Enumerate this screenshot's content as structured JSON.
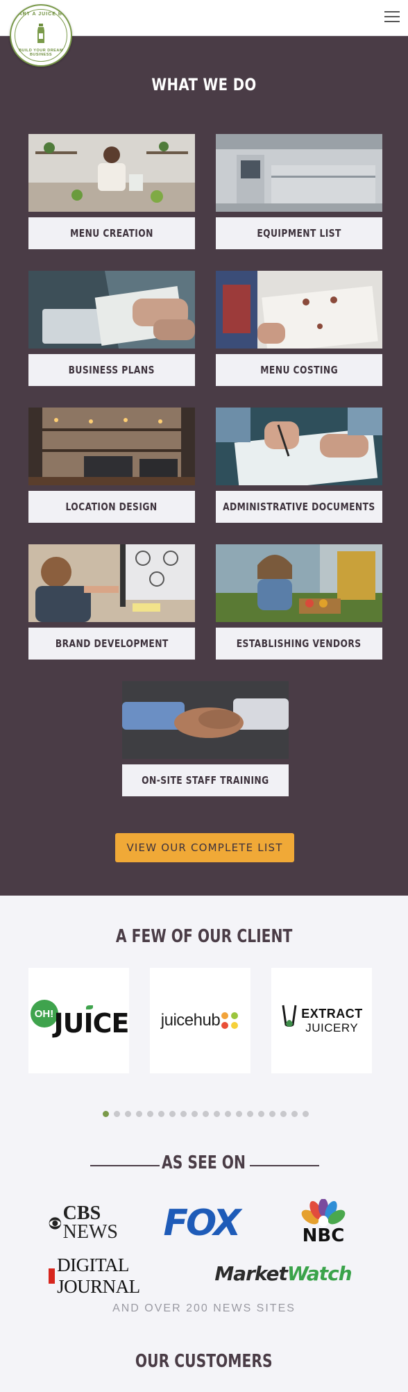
{
  "header": {
    "logo_top": "START A JUICE BAR",
    "logo_bottom": "BUILD YOUR DREAM BUSINESS",
    "menu_icon": "hamburger-menu-icon"
  },
  "services": {
    "title": "WHAT WE DO",
    "items": [
      {
        "label": "MENU CREATION"
      },
      {
        "label": "EQUIPMENT LIST"
      },
      {
        "label": "BUSINESS PLANS"
      },
      {
        "label": "MENU COSTING"
      },
      {
        "label": "LOCATION DESIGN"
      },
      {
        "label": "ADMINISTRATIVE DOCUMENTS"
      },
      {
        "label": "BRAND DEVELOPMENT"
      },
      {
        "label": "ESTABLISHING VENDORS"
      },
      {
        "label": "ON-SITE STAFF TRAINING"
      }
    ],
    "cta": "VIEW OUR COMPLETE LIST"
  },
  "clients": {
    "title": "A FEW OF OUR CLIENT",
    "logos": [
      {
        "badge": "OH!",
        "name": "JUICE"
      },
      {
        "name": "juicehub"
      },
      {
        "line1": "EXTRACT",
        "line2": "JUICERY"
      }
    ],
    "dots_count": 19,
    "active_dot": 0
  },
  "press": {
    "title": "AS SEE ON",
    "outlets": [
      {
        "line1": "CBS",
        "line2": "NEWS"
      },
      {
        "name": "FOX"
      },
      {
        "name": "NBC"
      },
      {
        "name": "DIGITAL JOURNAL"
      },
      {
        "part1": "Market",
        "part2": "Watch"
      }
    ],
    "footnote": "AND OVER 200 NEWS SITES"
  },
  "customers": {
    "title": "OUR CUSTOMERS"
  },
  "colors": {
    "dark_bg": "#4a3c46",
    "accent_orange": "#f0a937",
    "brand_green": "#7a9a4a",
    "page_bg": "#f4f4f8"
  }
}
